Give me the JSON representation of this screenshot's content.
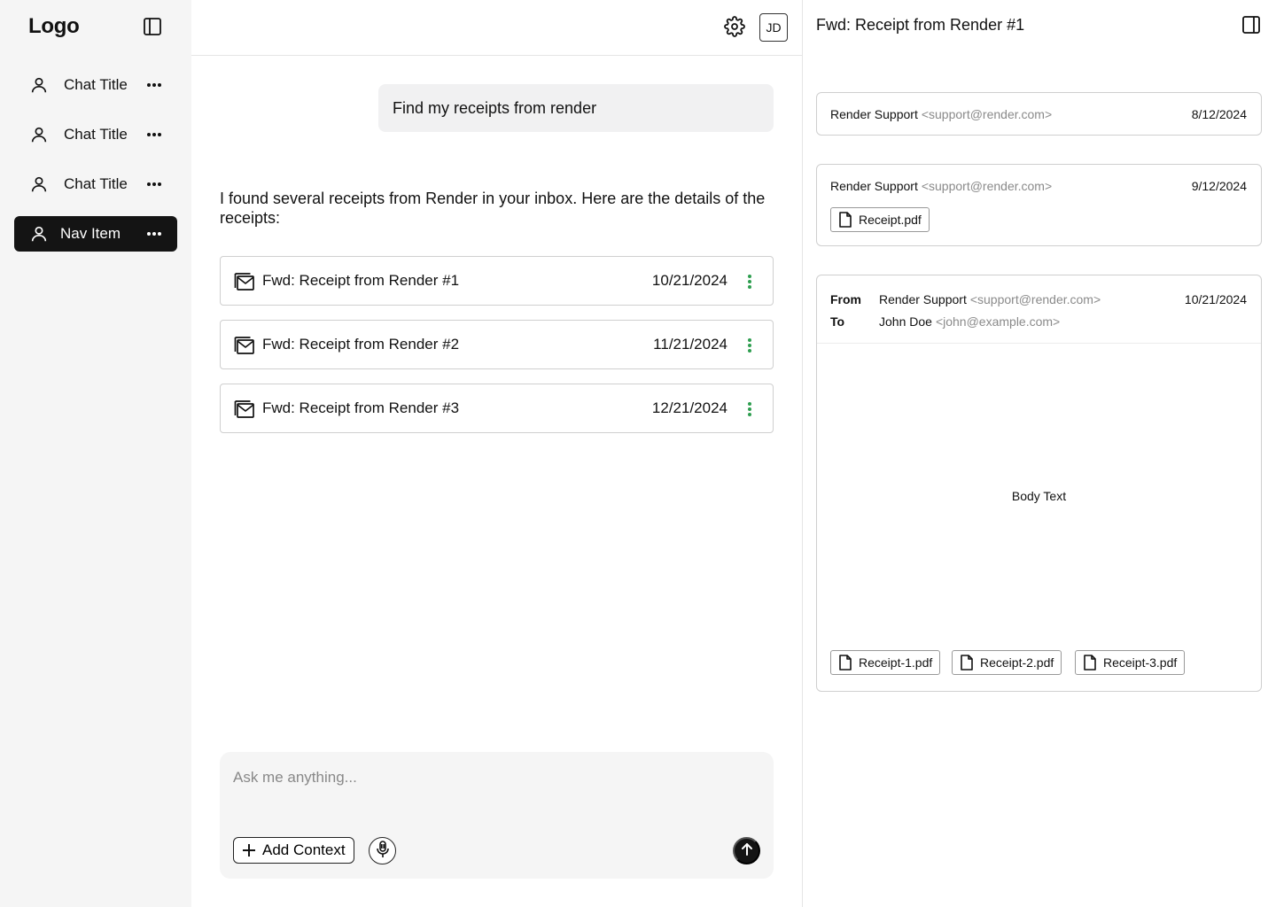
{
  "sidebar": {
    "logo": "Logo",
    "items": [
      {
        "label": "Chat Title"
      },
      {
        "label": "Chat Title"
      },
      {
        "label": "Chat Title"
      },
      {
        "label": "Nav Item"
      }
    ]
  },
  "header": {
    "avatar_initials": "JD"
  },
  "chat": {
    "user_message": "Find my receipts from render",
    "assistant_message": "I found several receipts from Render in your inbox. Here are the details of the receipts:",
    "emails": [
      {
        "subject": "Fwd: Receipt from Render #1",
        "date": "10/21/2024"
      },
      {
        "subject": "Fwd: Receipt from Render #2",
        "date": "11/21/2024"
      },
      {
        "subject": "Fwd: Receipt from Render #3",
        "date": "12/21/2024"
      }
    ]
  },
  "composer": {
    "placeholder": "Ask me anything...",
    "add_context_label": "Add Context"
  },
  "panel": {
    "title": "Fwd: Receipt from Render #1",
    "thread": [
      {
        "sender": "Render Support",
        "address": "<support@render.com>",
        "date": "8/12/2024"
      },
      {
        "sender": "Render Support",
        "address": "<support@render.com>",
        "date": "9/12/2024",
        "attachment": "Receipt.pdf"
      }
    ],
    "open_email": {
      "from_label": "From",
      "to_label": "To",
      "from_name": "Render Support",
      "from_address": "<support@render.com>",
      "to_name": "John Doe",
      "to_address": "<john@example.com>",
      "date": "10/21/2024",
      "body": "Body Text",
      "attachments": [
        "Receipt-1.pdf",
        "Receipt-2.pdf",
        "Receipt-3.pdf"
      ]
    }
  },
  "colors": {
    "accent_green": "#2e9e4f",
    "active_nav_bg": "#141414",
    "sidebar_bg": "#f5f5f5"
  }
}
